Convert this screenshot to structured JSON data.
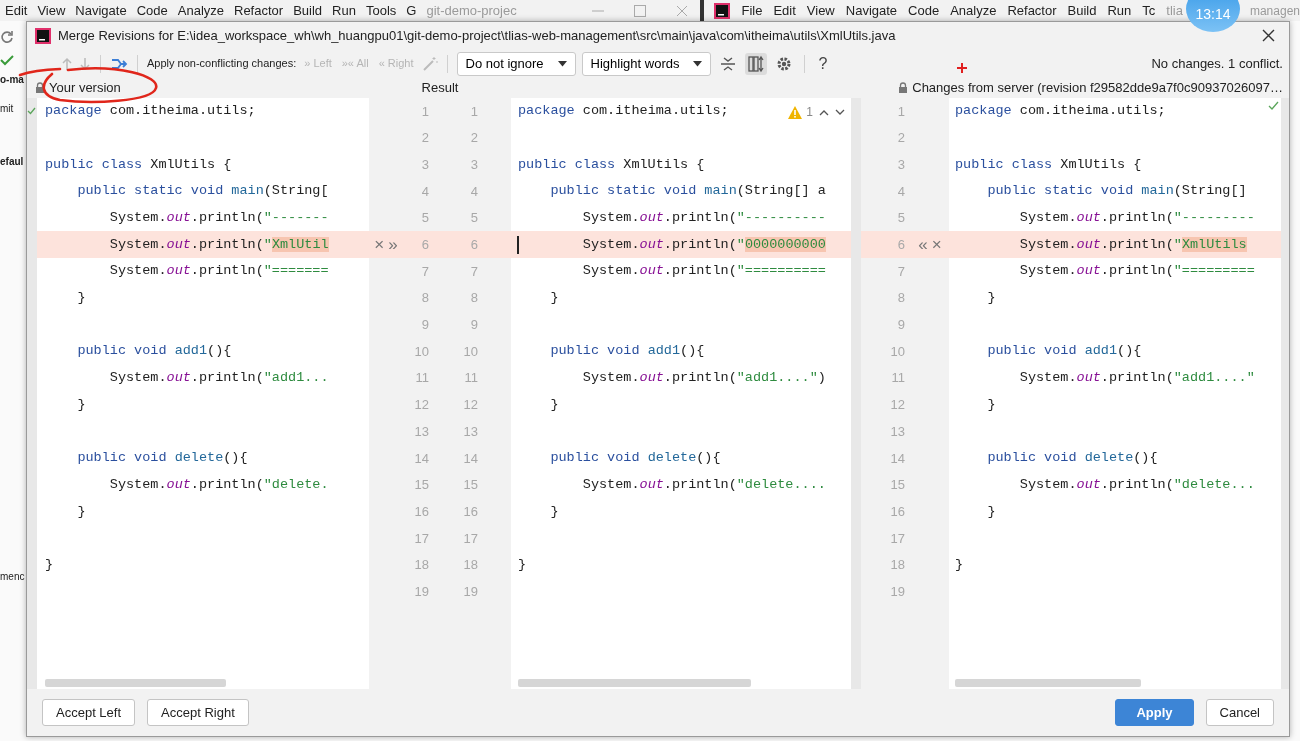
{
  "background": {
    "left_menu": [
      "Edit",
      "View",
      "Navigate",
      "Code",
      "Analyze",
      "Refactor",
      "Build",
      "Run",
      "Tools",
      "G"
    ],
    "left_title": "git-demo-projec",
    "right_menu": [
      "File",
      "Edit",
      "View",
      "Navigate",
      "Code",
      "Analyze",
      "Refactor",
      "Build",
      "Run",
      "Tc"
    ],
    "right_title": "tlia",
    "right_title_tail": "managen",
    "side_texts": [
      "o-ma",
      "mit",
      "efaul",
      "menc"
    ]
  },
  "clock": "13:14",
  "dialog": {
    "title": "Merge Revisions for E:\\idea_workspace_wh\\wh_huangpu01\\git-demo-project\\tlias-web-management\\src\\main\\java\\com\\itheima\\utils\\XmlUtils.java",
    "toolbar": {
      "apply_label": "Apply non-conflicting changes:",
      "apply_actions": [
        {
          "glyph": "»",
          "label": "Left",
          "disabled": true
        },
        {
          "glyph": "»«",
          "label": "All",
          "disabled": true
        },
        {
          "glyph": "«",
          "label": "Right",
          "disabled": true
        }
      ],
      "dropdowns": [
        {
          "label": "Do not ignore"
        },
        {
          "label": "Highlight words"
        }
      ],
      "view_buttons": [
        {
          "kind": "collapse",
          "selected": false
        },
        {
          "kind": "sync",
          "selected": true
        },
        {
          "kind": "settings",
          "selected": false
        }
      ],
      "help": "?",
      "status": "No changes. 1 conflict."
    },
    "panes": [
      {
        "header": "Your version",
        "lines": [
          {
            "n": "1",
            "conflict": false,
            "tokens": [
              {
                "kind": "kw",
                "text": "package"
              },
              {
                "kind": "p",
                "text": " com.itheima.utils;"
              }
            ]
          },
          {
            "n": "2",
            "conflict": false
          },
          {
            "n": "3",
            "conflict": false,
            "tokens": [
              {
                "kind": "kw",
                "text": "public class"
              },
              {
                "kind": "p",
                "text": " XmlUtils {"
              }
            ]
          },
          {
            "n": "4",
            "conflict": false,
            "tokens": [
              {
                "kind": "kw",
                "text": "    public static void"
              },
              {
                "kind": "m",
                "text": " main"
              },
              {
                "kind": "p",
                "text": "(String["
              }
            ]
          },
          {
            "n": "5",
            "conflict": false,
            "tokens": [
              {
                "kind": "p",
                "text": "        System."
              },
              {
                "kind": "f",
                "text": "out"
              },
              {
                "kind": "p",
                "text": ".println("
              },
              {
                "kind": "s",
                "text": "\"-------"
              }
            ]
          },
          {
            "n": "6",
            "conflict": true,
            "tokens": [
              {
                "kind": "p",
                "text": "        System."
              },
              {
                "kind": "f",
                "text": "out"
              },
              {
                "kind": "p",
                "text": ".println("
              },
              {
                "kind": "s",
                "text": "\""
              },
              {
                "kind": "c",
                "text": "XmlUtil"
              }
            ]
          },
          {
            "n": "7",
            "conflict": false,
            "tokens": [
              {
                "kind": "p",
                "text": "        System."
              },
              {
                "kind": "f",
                "text": "out"
              },
              {
                "kind": "p",
                "text": ".println("
              },
              {
                "kind": "s",
                "text": "\"======="
              }
            ]
          },
          {
            "n": "8",
            "conflict": false,
            "tokens": [
              {
                "kind": "p",
                "text": "    }"
              }
            ]
          },
          {
            "n": "9",
            "conflict": false
          },
          {
            "n": "10",
            "conflict": false,
            "tokens": [
              {
                "kind": "kw",
                "text": "    public void"
              },
              {
                "kind": "m",
                "text": " add1"
              },
              {
                "kind": "p",
                "text": "(){"
              }
            ]
          },
          {
            "n": "11",
            "conflict": false,
            "tokens": [
              {
                "kind": "p",
                "text": "        System."
              },
              {
                "kind": "f",
                "text": "out"
              },
              {
                "kind": "p",
                "text": ".println("
              },
              {
                "kind": "s",
                "text": "\"add1..."
              }
            ]
          },
          {
            "n": "12",
            "conflict": false,
            "tokens": [
              {
                "kind": "p",
                "text": "    }"
              }
            ]
          },
          {
            "n": "13",
            "conflict": false
          },
          {
            "n": "14",
            "conflict": false,
            "tokens": [
              {
                "kind": "kw",
                "text": "    public void"
              },
              {
                "kind": "m",
                "text": " delete"
              },
              {
                "kind": "p",
                "text": "(){"
              }
            ]
          },
          {
            "n": "15",
            "conflict": false,
            "tokens": [
              {
                "kind": "p",
                "text": "        System."
              },
              {
                "kind": "f",
                "text": "out"
              },
              {
                "kind": "p",
                "text": ".println("
              },
              {
                "kind": "s",
                "text": "\"delete."
              }
            ]
          },
          {
            "n": "16",
            "conflict": false,
            "tokens": [
              {
                "kind": "p",
                "text": "    }"
              }
            ]
          },
          {
            "n": "17",
            "conflict": false
          },
          {
            "n": "18",
            "conflict": false,
            "tokens": [
              {
                "kind": "p",
                "text": "}"
              }
            ]
          },
          {
            "n": "19",
            "conflict": false
          }
        ]
      },
      {
        "header": "Result",
        "inspection": {
          "count": "1"
        },
        "lines": [
          {
            "n": "1",
            "conflict": false,
            "tokens": [
              {
                "kind": "kw",
                "text": "package"
              },
              {
                "kind": "p",
                "text": " com.itheima.utils;"
              }
            ]
          },
          {
            "n": "2",
            "conflict": false
          },
          {
            "n": "3",
            "conflict": false,
            "tokens": [
              {
                "kind": "kw",
                "text": "public class"
              },
              {
                "kind": "p",
                "text": " XmlUtils {"
              }
            ]
          },
          {
            "n": "4",
            "conflict": false,
            "tokens": [
              {
                "kind": "kw",
                "text": "    public static void"
              },
              {
                "kind": "m",
                "text": " main"
              },
              {
                "kind": "p",
                "text": "(String[] a"
              }
            ]
          },
          {
            "n": "5",
            "conflict": false,
            "tokens": [
              {
                "kind": "p",
                "text": "        System."
              },
              {
                "kind": "f",
                "text": "out"
              },
              {
                "kind": "p",
                "text": ".println("
              },
              {
                "kind": "s",
                "text": "\"----------"
              }
            ]
          },
          {
            "n": "6",
            "conflict": true,
            "tokens": [
              {
                "kind": "p",
                "text": "        System."
              },
              {
                "kind": "f",
                "text": "out"
              },
              {
                "kind": "p",
                "text": ".println("
              },
              {
                "kind": "s",
                "text": "\""
              },
              {
                "kind": "c",
                "text": "0000000000"
              }
            ]
          },
          {
            "n": "7",
            "conflict": false,
            "tokens": [
              {
                "kind": "p",
                "text": "        System."
              },
              {
                "kind": "f",
                "text": "out"
              },
              {
                "kind": "p",
                "text": ".println("
              },
              {
                "kind": "s",
                "text": "\"=========="
              }
            ]
          },
          {
            "n": "8",
            "conflict": false,
            "tokens": [
              {
                "kind": "p",
                "text": "    }"
              }
            ]
          },
          {
            "n": "9",
            "conflict": false
          },
          {
            "n": "10",
            "conflict": false,
            "tokens": [
              {
                "kind": "kw",
                "text": "    public void"
              },
              {
                "kind": "m",
                "text": " add1"
              },
              {
                "kind": "p",
                "text": "(){"
              }
            ]
          },
          {
            "n": "11",
            "conflict": false,
            "tokens": [
              {
                "kind": "p",
                "text": "        System."
              },
              {
                "kind": "f",
                "text": "out"
              },
              {
                "kind": "p",
                "text": ".println("
              },
              {
                "kind": "s",
                "text": "\"add1....\""
              },
              {
                "kind": "p",
                "text": ")"
              }
            ]
          },
          {
            "n": "12",
            "conflict": false,
            "tokens": [
              {
                "kind": "p",
                "text": "    }"
              }
            ]
          },
          {
            "n": "13",
            "conflict": false
          },
          {
            "n": "14",
            "conflict": false,
            "tokens": [
              {
                "kind": "kw",
                "text": "    public void"
              },
              {
                "kind": "m",
                "text": " delete"
              },
              {
                "kind": "p",
                "text": "(){"
              }
            ]
          },
          {
            "n": "15",
            "conflict": false,
            "tokens": [
              {
                "kind": "p",
                "text": "        System."
              },
              {
                "kind": "f",
                "text": "out"
              },
              {
                "kind": "p",
                "text": ".println("
              },
              {
                "kind": "s",
                "text": "\"delete...."
              }
            ]
          },
          {
            "n": "16",
            "conflict": false,
            "tokens": [
              {
                "kind": "p",
                "text": "    }"
              }
            ]
          },
          {
            "n": "17",
            "conflict": false
          },
          {
            "n": "18",
            "conflict": false,
            "tokens": [
              {
                "kind": "p",
                "text": "}"
              }
            ]
          },
          {
            "n": "19",
            "conflict": false
          }
        ]
      },
      {
        "header": "Changes from server (revision f29582dde9a7f0c90937026097…",
        "lines": [
          {
            "n": "1",
            "conflict": false,
            "tokens": [
              {
                "kind": "kw",
                "text": "package"
              },
              {
                "kind": "p",
                "text": " com.itheima.utils;"
              }
            ]
          },
          {
            "n": "2",
            "conflict": false
          },
          {
            "n": "3",
            "conflict": false,
            "tokens": [
              {
                "kind": "kw",
                "text": "public class"
              },
              {
                "kind": "p",
                "text": " XmlUtils {"
              }
            ]
          },
          {
            "n": "4",
            "conflict": false,
            "tokens": [
              {
                "kind": "kw",
                "text": "    public static void"
              },
              {
                "kind": "m",
                "text": " main"
              },
              {
                "kind": "p",
                "text": "(String[]"
              }
            ]
          },
          {
            "n": "5",
            "conflict": false,
            "tokens": [
              {
                "kind": "p",
                "text": "        System."
              },
              {
                "kind": "f",
                "text": "out"
              },
              {
                "kind": "p",
                "text": ".println("
              },
              {
                "kind": "s",
                "text": "\"---------"
              }
            ]
          },
          {
            "n": "6",
            "conflict": true,
            "tokens": [
              {
                "kind": "p",
                "text": "        System."
              },
              {
                "kind": "f",
                "text": "out"
              },
              {
                "kind": "p",
                "text": ".println("
              },
              {
                "kind": "s",
                "text": "\""
              },
              {
                "kind": "c",
                "text": "XmlUtils"
              }
            ]
          },
          {
            "n": "7",
            "conflict": false,
            "tokens": [
              {
                "kind": "p",
                "text": "        System."
              },
              {
                "kind": "f",
                "text": "out"
              },
              {
                "kind": "p",
                "text": ".println("
              },
              {
                "kind": "s",
                "text": "\"========="
              }
            ]
          },
          {
            "n": "8",
            "conflict": false,
            "tokens": [
              {
                "kind": "p",
                "text": "    }"
              }
            ]
          },
          {
            "n": "9",
            "conflict": false
          },
          {
            "n": "10",
            "conflict": false,
            "tokens": [
              {
                "kind": "kw",
                "text": "    public void"
              },
              {
                "kind": "m",
                "text": " add1"
              },
              {
                "kind": "p",
                "text": "(){"
              }
            ]
          },
          {
            "n": "11",
            "conflict": false,
            "tokens": [
              {
                "kind": "p",
                "text": "        System."
              },
              {
                "kind": "f",
                "text": "out"
              },
              {
                "kind": "p",
                "text": ".println("
              },
              {
                "kind": "s",
                "text": "\"add1....\""
              }
            ]
          },
          {
            "n": "12",
            "conflict": false,
            "tokens": [
              {
                "kind": "p",
                "text": "    }"
              }
            ]
          },
          {
            "n": "13",
            "conflict": false
          },
          {
            "n": "14",
            "conflict": false,
            "tokens": [
              {
                "kind": "kw",
                "text": "    public void"
              },
              {
                "kind": "m",
                "text": " delete"
              },
              {
                "kind": "p",
                "text": "(){"
              }
            ]
          },
          {
            "n": "15",
            "conflict": false,
            "tokens": [
              {
                "kind": "p",
                "text": "        System."
              },
              {
                "kind": "f",
                "text": "out"
              },
              {
                "kind": "p",
                "text": ".println("
              },
              {
                "kind": "s",
                "text": "\"delete..."
              }
            ]
          },
          {
            "n": "16",
            "conflict": false,
            "tokens": [
              {
                "kind": "p",
                "text": "    }"
              }
            ]
          },
          {
            "n": "17",
            "conflict": false
          },
          {
            "n": "18",
            "conflict": false,
            "tokens": [
              {
                "kind": "p",
                "text": "}"
              }
            ]
          },
          {
            "n": "19",
            "conflict": false
          }
        ]
      }
    ],
    "gutter_actions": {
      "left": [
        "×",
        "»"
      ],
      "right": [
        "«",
        "×"
      ]
    },
    "buttons": [
      {
        "label": "Accept Left",
        "primary": false
      },
      {
        "label": "Accept Right",
        "primary": false
      },
      {
        "label": "Apply",
        "primary": true
      },
      {
        "label": "Cancel",
        "primary": false
      }
    ]
  }
}
